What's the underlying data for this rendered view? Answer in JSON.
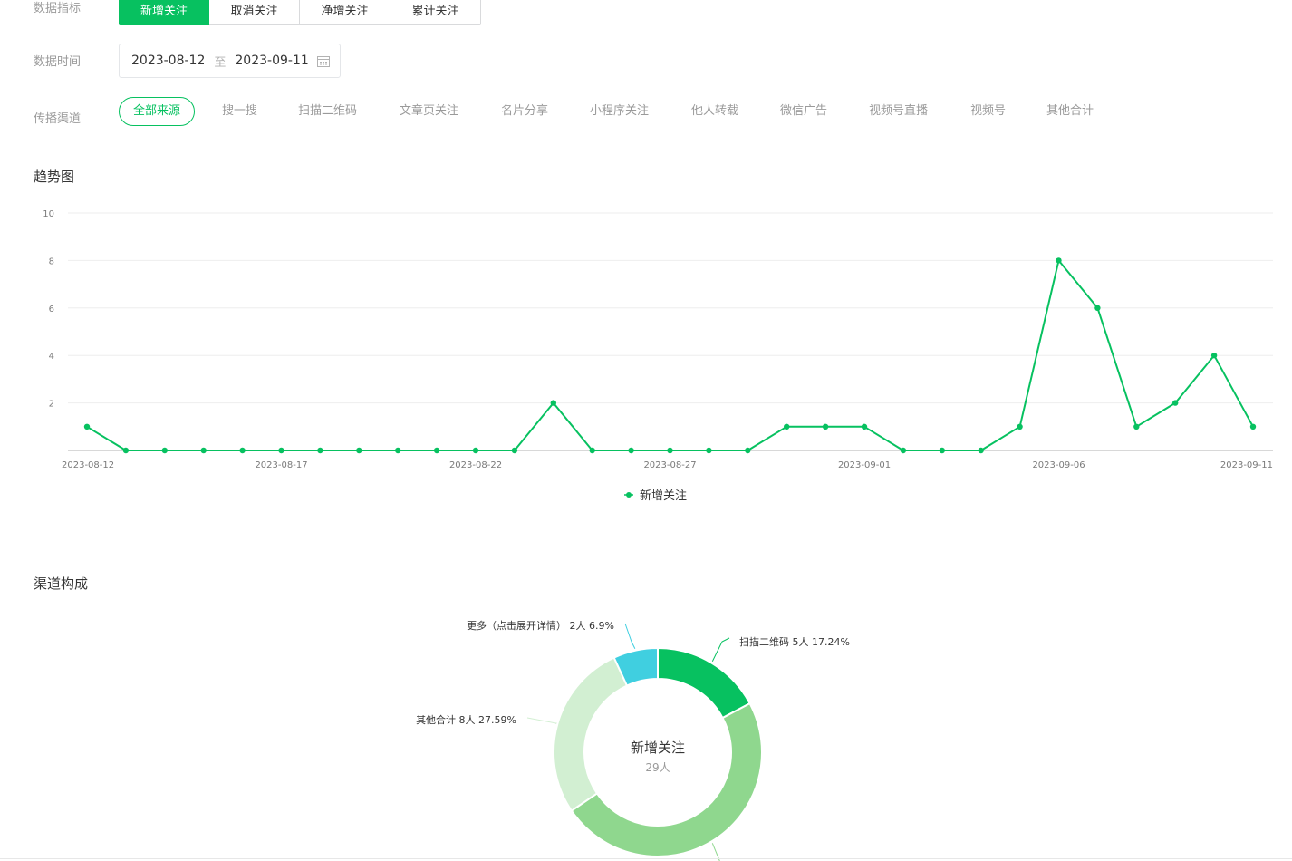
{
  "filters": {
    "metric_label": "数据指标",
    "metrics": [
      "新增关注",
      "取消关注",
      "净增关注",
      "累计关注"
    ],
    "metric_active": 0,
    "date_label": "数据时间",
    "date_start": "2023-08-12",
    "date_sep": "至",
    "date_end": "2023-09-11",
    "channel_label": "传播渠道",
    "channels": [
      "全部来源",
      "搜一搜",
      "扫描二维码",
      "文章页关注",
      "名片分享",
      "小程序关注",
      "他人转载",
      "微信广告",
      "视频号直播",
      "视频号",
      "其他合计"
    ],
    "channel_active": 0
  },
  "trend": {
    "title": "趋势图"
  },
  "composition": {
    "title": "渠道构成"
  },
  "colors": {
    "accent": "#07c160",
    "grid": "#eeeeee",
    "axis": "#cccccc"
  },
  "chart_data": [
    {
      "type": "line",
      "x": [
        "2023-08-12",
        "2023-08-13",
        "2023-08-14",
        "2023-08-15",
        "2023-08-16",
        "2023-08-17",
        "2023-08-18",
        "2023-08-19",
        "2023-08-20",
        "2023-08-21",
        "2023-08-22",
        "2023-08-23",
        "2023-08-24",
        "2023-08-25",
        "2023-08-26",
        "2023-08-27",
        "2023-08-28",
        "2023-08-29",
        "2023-08-30",
        "2023-08-31",
        "2023-09-01",
        "2023-09-02",
        "2023-09-03",
        "2023-09-04",
        "2023-09-05",
        "2023-09-06",
        "2023-09-07",
        "2023-09-08",
        "2023-09-09",
        "2023-09-10",
        "2023-09-11"
      ],
      "x_tick_labels": [
        "2023-08-12",
        "2023-08-17",
        "2023-08-22",
        "2023-08-27",
        "2023-09-01",
        "2023-09-06",
        "2023-09-11"
      ],
      "y_ticks": [
        2,
        4,
        6,
        8,
        10
      ],
      "ylim": [
        0,
        10
      ],
      "series": [
        {
          "name": "新增关注",
          "color": "#07c160",
          "values": [
            1,
            0,
            0,
            0,
            0,
            0,
            0,
            0,
            0,
            0,
            0,
            0,
            2,
            0,
            0,
            0,
            0,
            0,
            1,
            1,
            1,
            0,
            0,
            0,
            1,
            8,
            6,
            1,
            2,
            4,
            1
          ]
        }
      ],
      "grid": true,
      "legend": "bottom-center"
    },
    {
      "type": "pie",
      "donut": true,
      "center_title": "新增关注",
      "center_sub": "29人",
      "slices": [
        {
          "label": "扫描二维码 5人 17.24%",
          "value": 5,
          "color": "#07c160"
        },
        {
          "label": "",
          "value": 14,
          "color": "#8fd78e"
        },
        {
          "label": "其他合计 8人 27.59%",
          "value": 8,
          "color": "#d2efd2"
        },
        {
          "label": "更多（点击展开详情） 2人 6.9%",
          "value": 2,
          "color": "#40cfe0"
        }
      ]
    }
  ]
}
